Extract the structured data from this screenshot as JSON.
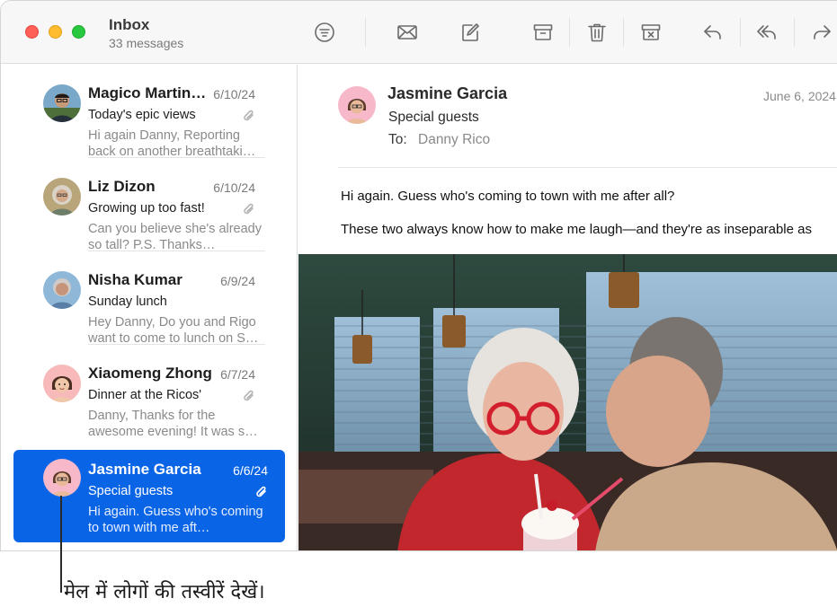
{
  "toolbar": {
    "mailbox_title": "Inbox",
    "mailbox_subtitle": "33 messages",
    "icons": [
      "filter-icon",
      "envelope-icon",
      "compose-icon",
      "archive-icon",
      "trash-icon",
      "junk-icon",
      "reply-icon",
      "reply-all-icon",
      "forward-icon"
    ]
  },
  "messages": [
    {
      "sender": "Magico Martin…",
      "date": "6/10/24",
      "subject": "Today's epic views",
      "preview": "Hi again Danny, Reporting back on another breathtaki…",
      "attachment": true
    },
    {
      "sender": "Liz Dizon",
      "date": "6/10/24",
      "subject": "Growing up too fast!",
      "preview": "Can you believe she's already so tall? P.S. Thanks…",
      "attachment": true
    },
    {
      "sender": "Nisha Kumar",
      "date": "6/9/24",
      "subject": "Sunday lunch",
      "preview": "Hey Danny, Do you and Rigo want to come to lunch on S…",
      "attachment": false
    },
    {
      "sender": "Xiaomeng Zhong",
      "date": "6/7/24",
      "subject": "Dinner at the Ricos'",
      "preview": "Danny, Thanks for the awesome evening! It was s…",
      "attachment": true
    },
    {
      "sender": "Jasmine Garcia",
      "date": "6/6/24",
      "subject": "Special guests",
      "preview": "Hi again. Guess who's coming to town with me aft…",
      "attachment": true,
      "selected": true
    }
  ],
  "reader": {
    "sender": "Jasmine Garcia",
    "date": "June 6, 2024",
    "subject": "Special guests",
    "to_label": "To:",
    "to": "Danny Rico",
    "body_line1": "Hi again. Guess who's coming to town with me after all?",
    "body_line2": "These two always know how to make me laugh—and they're as inseparable as"
  },
  "caption": "मेल में लोगों की तस्वीरें देखें।",
  "colors": {
    "selection": "#0a64e6",
    "traffic_red": "#fe5f57",
    "traffic_yellow": "#febc2e",
    "traffic_green": "#28c840"
  }
}
